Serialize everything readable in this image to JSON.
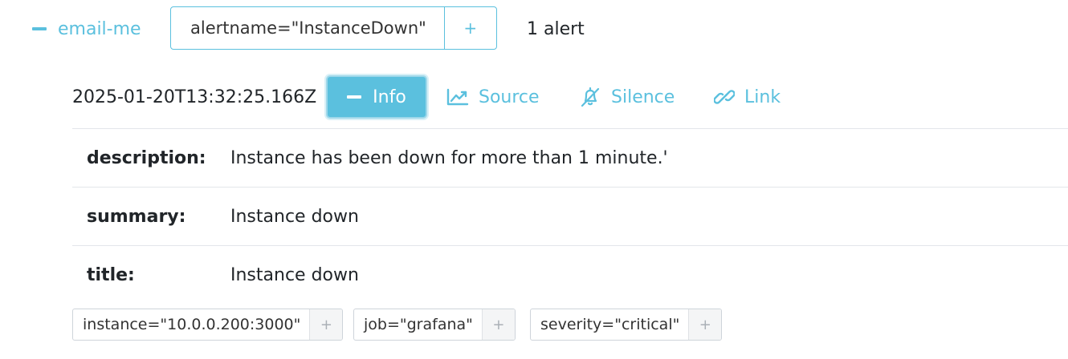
{
  "group": {
    "name": "email-me",
    "filter_label": "alertname=\"InstanceDown\"",
    "filter_add": "+",
    "alert_count": "1 alert"
  },
  "alert": {
    "timestamp": "2025-01-20T13:32:25.166Z",
    "toolbar": {
      "info_label": "Info",
      "source_label": "Source",
      "silence_label": "Silence",
      "link_label": "Link"
    },
    "annotations": [
      {
        "key": "description:",
        "value": "Instance has been down for more than 1 minute.'"
      },
      {
        "key": "summary:",
        "value": "Instance down"
      },
      {
        "key": "title:",
        "value": "Instance down"
      }
    ],
    "labels": [
      {
        "text": "instance=\"10.0.0.200:3000\"",
        "add": "+"
      },
      {
        "text": "job=\"grafana\"",
        "add": "+"
      },
      {
        "text": "severity=\"critical\"",
        "add": "+"
      }
    ]
  },
  "colors": {
    "accent": "#5bc0de",
    "text": "#212529",
    "border": "#ced4da"
  },
  "icons": {
    "collapse": "minus-icon",
    "source": "chart-line-icon",
    "silence": "bell-slash-icon",
    "link": "link-icon"
  }
}
